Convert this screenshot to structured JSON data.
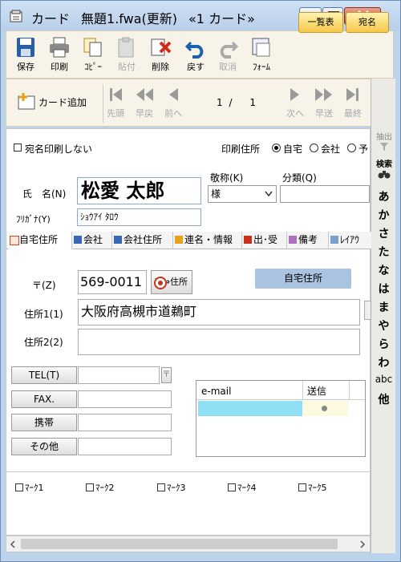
{
  "title": {
    "app": "カード",
    "file": "無題1.fwa(更新)",
    "card": "«1 カード»"
  },
  "toolbar": {
    "save": "保存",
    "print": "印刷",
    "copy": "ｺﾋﾟｰ",
    "paste": "貼付",
    "delete": "削除",
    "undo": "戻す",
    "redo": "取消",
    "form": "ﾌｫｰﾑ",
    "list_view": "一覧表",
    "card_view": "宛名"
  },
  "nav": {
    "add_card": "カード追加",
    "first": "先頭",
    "fast_back": "早戻",
    "prev": "前へ",
    "page_current": "1",
    "page_sep": "/",
    "page_total": "1",
    "next": "次へ",
    "fast_fwd": "早送",
    "last": "最終"
  },
  "strip": {
    "extract": "抽出",
    "search": "検索",
    "kana": [
      "あ",
      "か",
      "さ",
      "た",
      "な",
      "は",
      "ま",
      "や",
      "ら",
      "わ",
      "abc",
      "他"
    ]
  },
  "form": {
    "no_name_print": "宛名印刷しない",
    "print_address_label": "印刷住所",
    "radio_home": "自宅",
    "radio_company": "会社",
    "radio_other": "予",
    "name_label": "氏　名(N)",
    "name_value": "松愛 太郎",
    "furigana_label": "ﾌﾘｶﾞﾅ(Y)",
    "furigana_value": "ｼｮｳｱｲ ﾀﾛｳ",
    "honorific_label": "敬称(K)",
    "honorific_value": "様",
    "category_label": "分類(Q)",
    "category_value": ""
  },
  "tabs": [
    "自宅住所",
    "会社",
    "会社住所",
    "連名・情報",
    "出･受",
    "備考",
    "ﾚｲｱｳ"
  ],
  "address": {
    "zip_label": "〒(Z)",
    "zip_value": "569-0011",
    "zip_convert": "〒⇔住所",
    "section_badge": "自宅住所",
    "addr1_label": "住所1(1)",
    "addr1_value": "大阪府高槻市道鵜町",
    "addr2_label": "住所2(2)",
    "addr2_value": "",
    "tel": "TEL(T)",
    "fax": "FAX.",
    "mobile": "携帯",
    "other": "その他",
    "tel_value": "",
    "fax_value": "",
    "mobile_value": "",
    "other_value": ""
  },
  "email_table": {
    "col_email": "e-mail",
    "col_send": "送信"
  },
  "marks": [
    "ﾏｰｸ1",
    "ﾏｰｸ2",
    "ﾏｰｸ3",
    "ﾏｰｸ4",
    "ﾏｰｸ5"
  ],
  "colors": {
    "title_bar": "#bcd3ec",
    "close": "#c7432c",
    "badge": "#a9c3e0",
    "email_cell": "#8fe0f5"
  }
}
